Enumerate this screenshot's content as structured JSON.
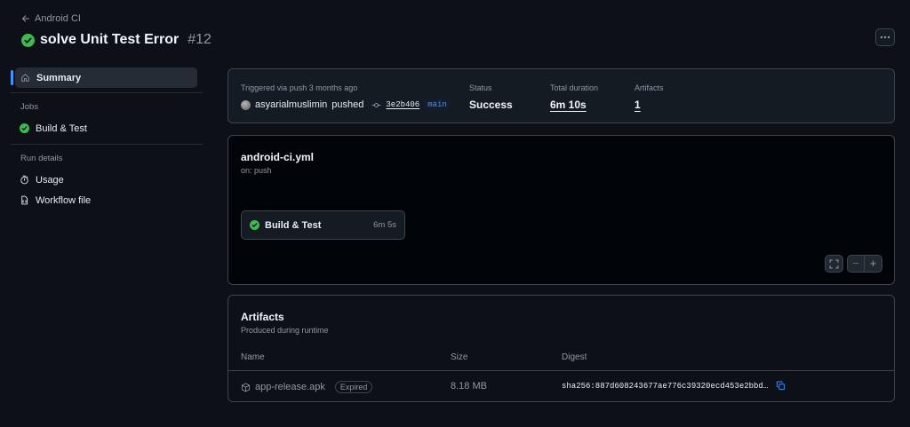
{
  "header": {
    "back_label": "Android CI",
    "run_title": "solve Unit Test Error",
    "run_number": "#12",
    "more_label": "···"
  },
  "sidebar": {
    "summary_label": "Summary",
    "jobs_heading": "Jobs",
    "job_label": "Build & Test",
    "run_details_heading": "Run details",
    "usage_label": "Usage",
    "workflow_file_label": "Workflow file"
  },
  "summary": {
    "trigger_text": "Triggered via push 3 months ago",
    "actor": "asyarialmuslimin",
    "action": "pushed",
    "commit_sha": "3e2b406",
    "branch": "main",
    "status_label": "Status",
    "status_value": "Success",
    "duration_label": "Total duration",
    "duration_value": "6m 10s",
    "artifacts_label": "Artifacts",
    "artifacts_value": "1"
  },
  "graph": {
    "workflow_file": "android-ci.yml",
    "trigger": "on: push",
    "job_name": "Build & Test",
    "job_duration": "6m 5s",
    "zoom_out": "−",
    "zoom_in": "+"
  },
  "artifacts": {
    "title": "Artifacts",
    "subtitle": "Produced during runtime",
    "columns": [
      "Name",
      "Size",
      "Digest"
    ],
    "rows": [
      {
        "name": "app-release.apk",
        "badge": "Expired",
        "size": "8.18 MB",
        "digest": "sha256:887d608243677ae776c39320ecd453e2bbd…"
      }
    ]
  },
  "colors": {
    "background": "#0d1117",
    "success": "#3fb950",
    "accent": "#4493f8",
    "border": "#3d444d"
  },
  "icons": [
    "arrow-left-icon",
    "check-circle-icon",
    "kebab-icon",
    "home-icon",
    "stopwatch-icon",
    "file-code-icon",
    "git-commit-icon",
    "fullscreen-icon",
    "package-icon",
    "copy-icon"
  ]
}
